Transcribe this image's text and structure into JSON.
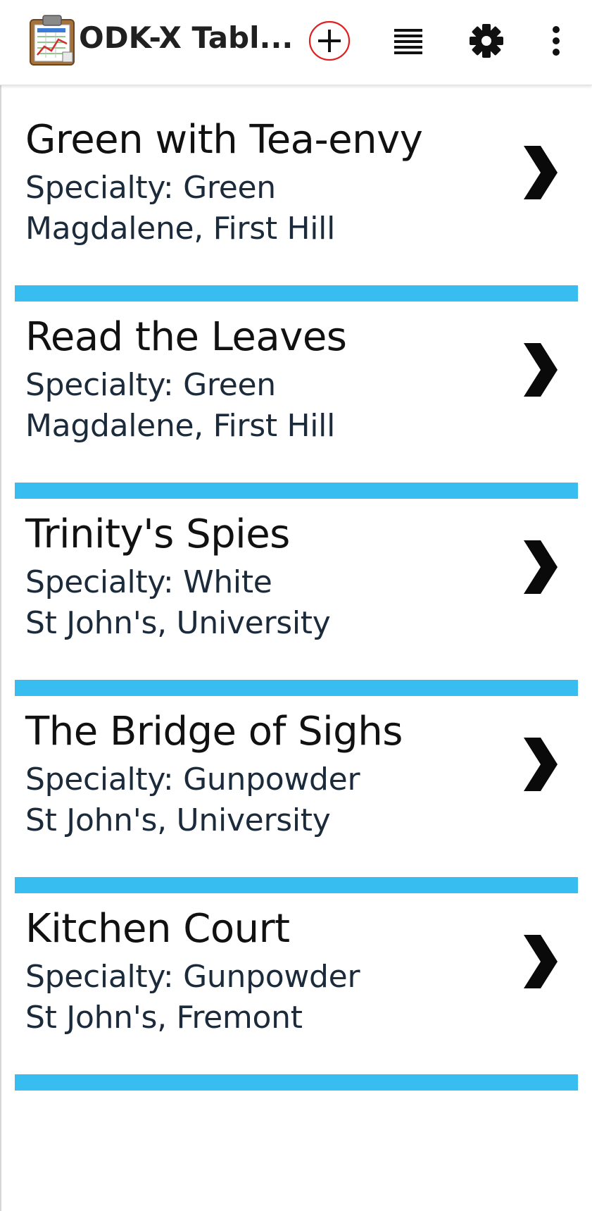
{
  "appbar": {
    "title": "ODK-X Tabl...",
    "icons": {
      "app": "clipboard-chart-icon",
      "add": "add-circle-icon",
      "list": "list-lines-icon",
      "settings": "gear-icon",
      "more": "more-vertical-icon"
    }
  },
  "colors": {
    "divider": "#37bdf0",
    "highlight_circle": "#e02020",
    "title_text": "#111111",
    "detail_text": "#1b2b3b"
  },
  "items": [
    {
      "name": "Green with Tea-envy",
      "specialty": "Specialty: Green",
      "location": "Magdalene, First Hill"
    },
    {
      "name": "Read the Leaves",
      "specialty": "Specialty: Green",
      "location": "Magdalene, First Hill"
    },
    {
      "name": "Trinity's Spies",
      "specialty": "Specialty: White",
      "location": "St John's, University"
    },
    {
      "name": "The Bridge of Sighs",
      "specialty": "Specialty: Gunpowder",
      "location": "St John's, University"
    },
    {
      "name": "Kitchen Court",
      "specialty": "Specialty: Gunpowder",
      "location": "St John's, Fremont"
    }
  ]
}
